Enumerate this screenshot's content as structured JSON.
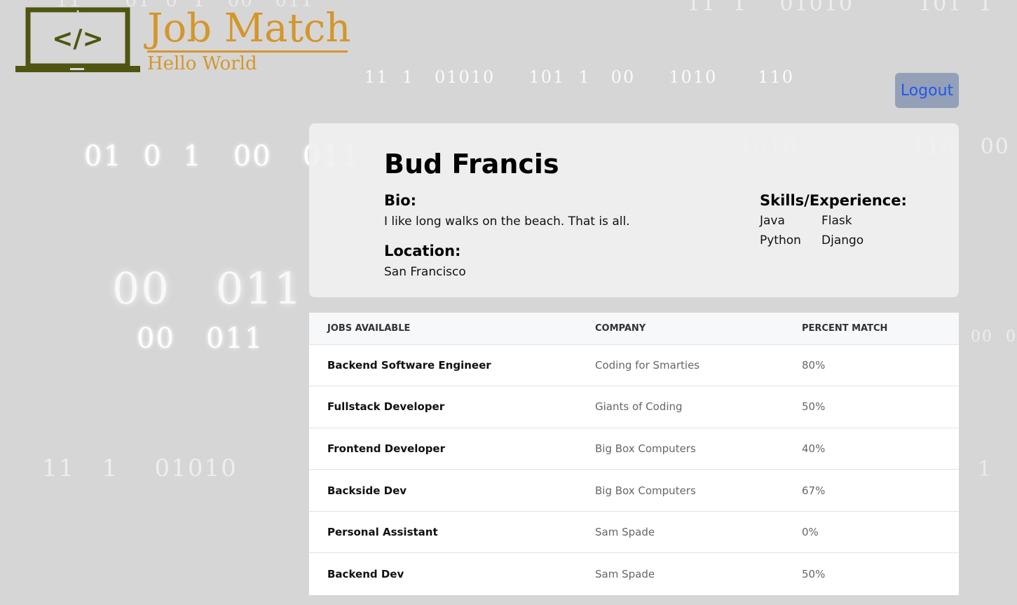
{
  "logo": {
    "code_glyph": "</>",
    "title": "Job Match",
    "subtitle": "Hello World"
  },
  "header": {
    "logout_label": "Logout"
  },
  "background_binary": [
    "01  0  1   00   011",
    "00   011",
    "00   011",
    "11  1   01010     101  1   00     1010      110",
    "11   1    01010",
    "11  1    01010        101  1",
    "1010              110   00    1",
    "00  0",
    "11      01  0  1   00   011",
    "1"
  ],
  "profile": {
    "name": "Bud Francis",
    "bio_label": "Bio:",
    "bio": "I like long walks on the beach. That is all.",
    "location_label": "Location:",
    "location": "San Francisco",
    "skills_label": "Skills/Experience:",
    "skills": [
      "Java",
      "Flask",
      "Python",
      "Django"
    ]
  },
  "jobs_table": {
    "headers": [
      "Jobs Available",
      "Company",
      "Percent Match"
    ],
    "rows": [
      {
        "title": "Backend Software Engineer",
        "company": "Coding for Smarties",
        "match": "80%"
      },
      {
        "title": "Fullstack Developer",
        "company": "Giants of Coding",
        "match": "50%"
      },
      {
        "title": "Frontend Developer",
        "company": "Big Box Computers",
        "match": "40%"
      },
      {
        "title": "Backside Dev",
        "company": "Big Box Computers",
        "match": "67%"
      },
      {
        "title": "Personal Assistant",
        "company": "Sam Spade",
        "match": "0%"
      },
      {
        "title": "Backend Dev",
        "company": "Sam Spade",
        "match": "50%"
      }
    ]
  },
  "colors": {
    "background": "#d6d6d6",
    "logo_accent": "#d4962b",
    "logo_laptop": "#4f5510",
    "logout_bg": "#93a0b8",
    "logout_text": "#2557e8"
  }
}
